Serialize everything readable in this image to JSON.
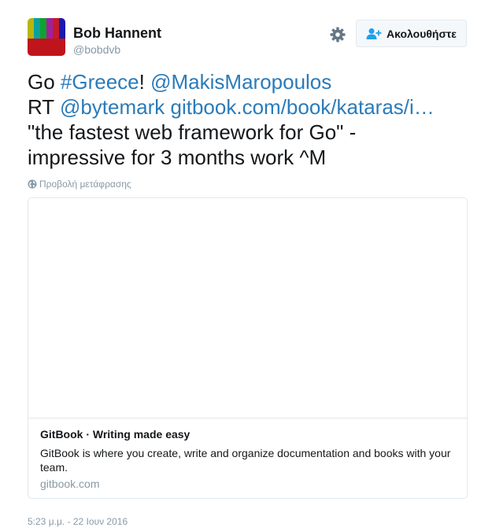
{
  "author": {
    "name": "Bob Hannent",
    "handle": "@bobdvb",
    "avatar_bar_colors": [
      "#b6b60e",
      "#0aa0a0",
      "#12a12a",
      "#a020a0",
      "#c41a2a",
      "#1a1ab0"
    ],
    "avatar_bottom_color": "#c0141c"
  },
  "actions": {
    "settings_icon": "gear-icon",
    "follow_icon": "add-user-icon",
    "follow_label": "Ακολουθήστε"
  },
  "tweet": {
    "line1": {
      "word1": "Go",
      "hashtag": "#Greece",
      "punct": "!",
      "mention": "@MakisMaropoulos"
    },
    "line2": {
      "word1": "RT",
      "mention": "@bytemark",
      "url": "gitbook.com/book/kataras/i…"
    },
    "line3": "\"the fastest web framework for Go\" -",
    "line4": "impressive for 3 months work ^M"
  },
  "translation_label": "Προβολή μετάφρασης",
  "card": {
    "title": "GitBook · Writing made easy",
    "description": "GitBook is where you create, write and organize documentation and books with your team.",
    "domain": "gitbook.com"
  },
  "timestamp": "5:23 μ.μ. - 22 Ιουν 2016",
  "colors": {
    "link": "#2b7bb9",
    "muted": "#8899a6",
    "border": "#e1e8ed"
  }
}
